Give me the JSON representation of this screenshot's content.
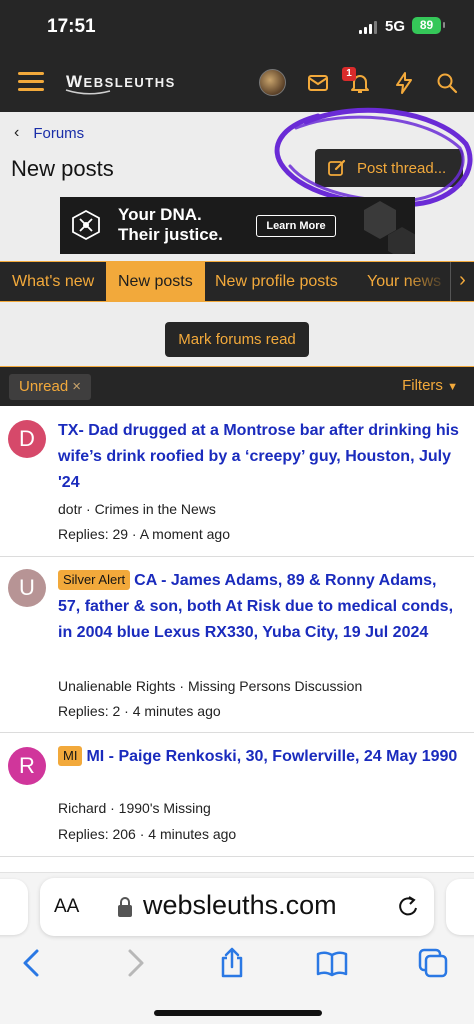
{
  "status_bar": {
    "time": "17:51",
    "network": "5G",
    "battery": "89"
  },
  "header": {
    "logo": {
      "first": "W",
      "rest": "EBSLEUTHS"
    },
    "alerts_count": "1",
    "icons": [
      "menu-icon",
      "avatar",
      "mail-icon",
      "bell-icon",
      "bolt-icon",
      "search-icon"
    ]
  },
  "breadcrumb": {
    "label": "Forums"
  },
  "page": {
    "title": "New posts",
    "post_thread_label": "Post thread..."
  },
  "ad": {
    "line1": "Your DNA.",
    "line2": "Their justice.",
    "button": "Learn More"
  },
  "tabs": [
    {
      "label": "What's new",
      "active": false
    },
    {
      "label": "New posts",
      "active": true
    },
    {
      "label": "New profile posts",
      "active": false
    },
    {
      "label": "Your news",
      "active": false
    }
  ],
  "mark_read_label": "Mark forums read",
  "filters": {
    "chip_label": "Unread",
    "chip_close": "×",
    "filters_label": "Filters"
  },
  "threads": [
    {
      "avatar_letter": "D",
      "avatar_color": "#d6496a",
      "prefix": "",
      "title": "TX- Dad drugged at a Montrose bar after drinking his wife’s drink roofied by a ‘creepy’ guy, Houston, July '24",
      "meta": "dotr · Crimes in the News",
      "stats": "Replies: 29 · A moment ago"
    },
    {
      "avatar_letter": "U",
      "avatar_color": "#b79495",
      "prefix": "Silver Alert",
      "title": "CA - James Adams, 89 & Ronny Adams, 57, father & son, both At Risk due to medical conds, in 2004 blue Lexus RX330, Yuba City, 19 Jul 2024",
      "meta": "Unalienable Rights · Missing Persons Discussion",
      "stats": "Replies: 2 · 4 minutes ago"
    },
    {
      "avatar_letter": "R",
      "avatar_color": "#d0369b",
      "prefix": "MI",
      "title": "MI - Paige Renkoski, 30, Fowlerville, 24 May 1990",
      "meta": "Richard · 1990's Missing",
      "stats": "Replies: 206 · 4 minutes ago"
    }
  ],
  "safari": {
    "aa": "AA",
    "url": "websleuths.com"
  },
  "colors": {
    "accent": "#f2a93b",
    "dark": "#262626",
    "link": "#1a2bbd",
    "annotation": "#6a2bd6"
  }
}
